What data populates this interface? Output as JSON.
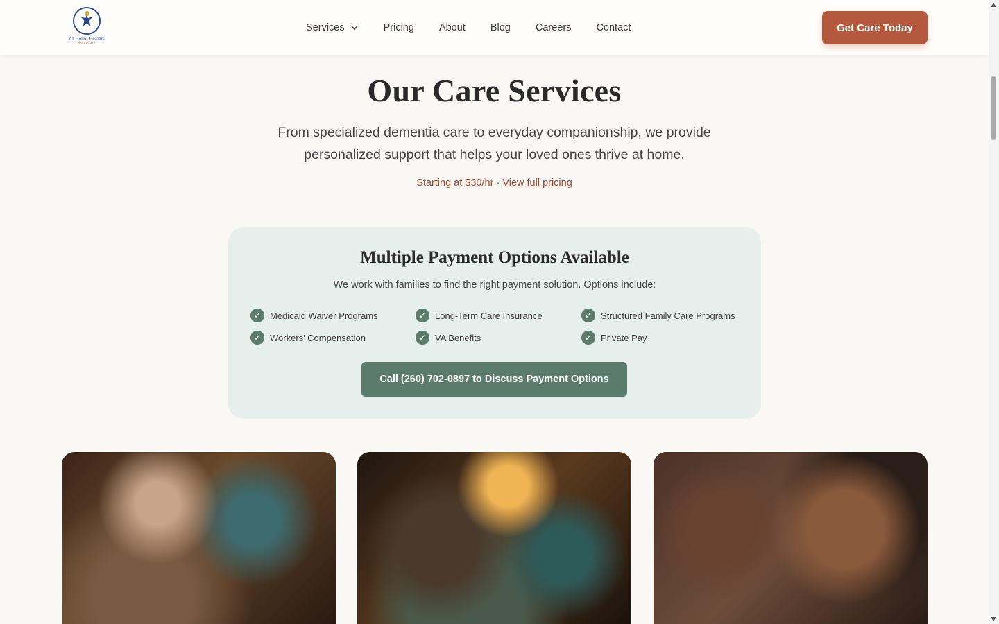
{
  "brand": {
    "name": "At Home Healers",
    "sub": "HomeCare",
    "accent": "#b4593d",
    "green": "#5b7c6c"
  },
  "nav": {
    "items": [
      "Services",
      "Pricing",
      "About",
      "Blog",
      "Careers",
      "Contact"
    ],
    "cta": "Get Care Today"
  },
  "hero": {
    "title": "Our Care Services",
    "subtitle": "From specialized dementia care to everyday companionship, we provide personalized support that helps your loved ones thrive at home.",
    "pricing_text": "Starting at $30/hr · ",
    "pricing_link": "View full pricing"
  },
  "payment": {
    "title": "Multiple Payment Options Available",
    "subtitle": "We work with families to find the right payment solution. Options include:",
    "options": [
      "Medicaid Waiver Programs",
      "Long-Term Care Insurance",
      "Structured Family Care Programs",
      "Workers’ Compensation",
      "VA Benefits",
      "Private Pay"
    ],
    "button": "Call (260) 702-0897 to Discuss Payment Options"
  },
  "cards": [
    {
      "image": "elderly-woman-with-caregiver-photo"
    },
    {
      "image": "resting-woman-with-nurse-photo"
    },
    {
      "image": "smiling-women-portrait-photo"
    }
  ]
}
